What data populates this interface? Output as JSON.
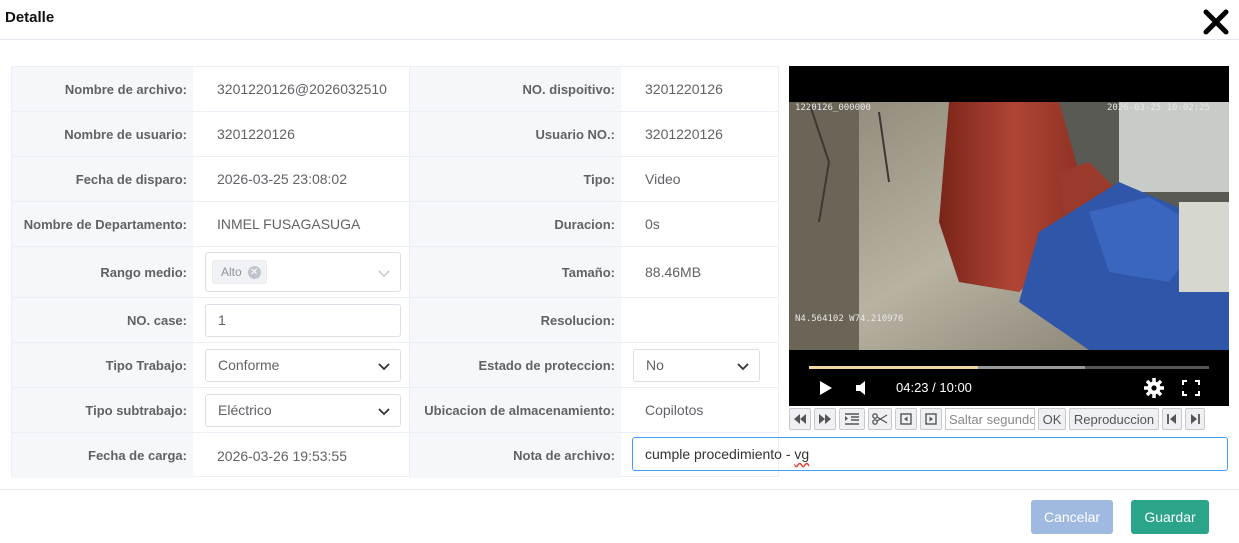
{
  "dialog": {
    "title": "Detalle"
  },
  "fields": {
    "file_name": {
      "label": "Nombre de archivo:",
      "value": "3201220126@2026032510"
    },
    "device_no": {
      "label": "NO. dispoitivo:",
      "value": "3201220126"
    },
    "user_name": {
      "label": "Nombre de usuario:",
      "value": "3201220126"
    },
    "user_no": {
      "label": "Usuario NO.:",
      "value": "3201220126"
    },
    "trigger_date": {
      "label": "Fecha de disparo:",
      "value": "2026-03-25 23:08:02"
    },
    "type": {
      "label": "Tipo:",
      "value": "Video"
    },
    "department": {
      "label": "Nombre de Departamento:",
      "value": "INMEL FUSAGASUGA"
    },
    "duration": {
      "label": "Duracion:",
      "value": "0s"
    },
    "range": {
      "label": "Rango medio:",
      "tag": "Alto"
    },
    "size": {
      "label": "Tamaño:",
      "value": "88.46MB"
    },
    "case_no": {
      "label": "NO. case:",
      "value": "1"
    },
    "resolution": {
      "label": "Resolucion:",
      "value": ""
    },
    "work_type": {
      "label": "Tipo Trabajo:",
      "value": "Conforme"
    },
    "protection": {
      "label": "Estado de proteccion:",
      "value": "No"
    },
    "subwork": {
      "label": "Tipo subtrabajo:",
      "value": "Eléctrico"
    },
    "storage": {
      "label": "Ubicacion de almacenamiento:",
      "value": "Copilotos"
    },
    "upload_date": {
      "label": "Fecha de carga:",
      "value": "2026-03-26 19:53:55"
    },
    "note": {
      "label": "Nota de archivo:",
      "value_main": "cumple procedimiento - ",
      "value_flagged": "vg"
    }
  },
  "player": {
    "overlay_top_left": "1220126_000000",
    "overlay_top_right": "2026-03-25 10:02:25",
    "overlay_gps": "N4.564102 W74.210976",
    "time_display": "04:23 / 10:00",
    "progress_played": 0.423,
    "progress_buffered": 0.69,
    "jump_placeholder": "Saltar segundos",
    "ok_label": "OK",
    "playback_label": "Reproduccion"
  },
  "footer": {
    "cancel_label": "Cancelar",
    "save_label": "Guardar"
  },
  "colors": {
    "primary": "#409eff",
    "save": "#2aa58a",
    "cancel": "#a0b9e0"
  }
}
